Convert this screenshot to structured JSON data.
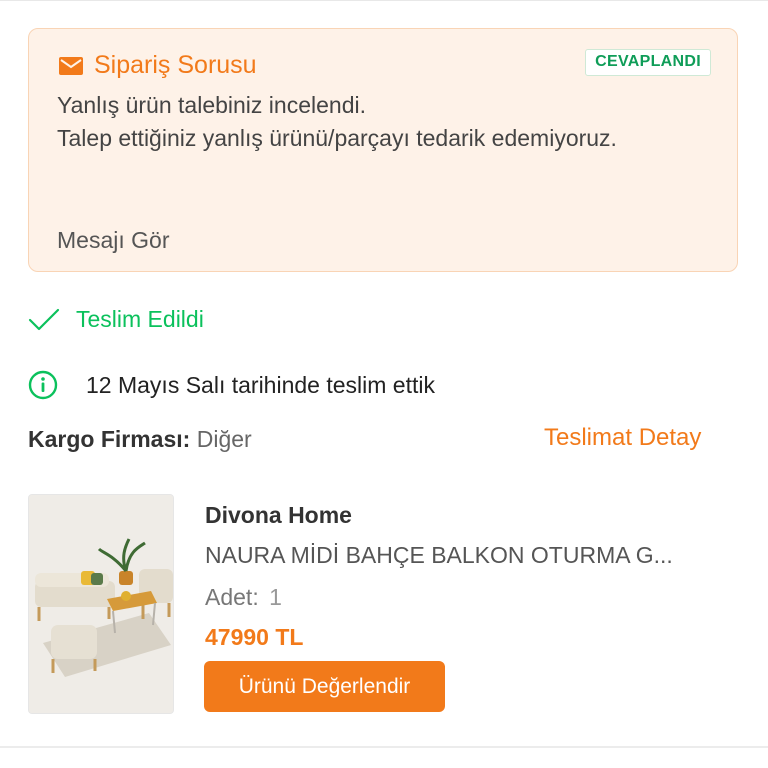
{
  "question_card": {
    "icon": "mail-icon",
    "title": "Sipariş Sorusu",
    "badge": "CEVAPLANDI",
    "message_line1": "Yanlış ürün talebiniz incelendi.",
    "message_line2": "Talep ettiğiniz yanlış ürünü/parçayı tedarik edemiyoruz.",
    "see_message": "Mesajı Gör"
  },
  "delivery": {
    "status_icon": "check-icon",
    "status": "Teslim Edildi",
    "info_icon": "info-icon",
    "info": "12 Mayıs Salı tarihinde teslim ettik",
    "cargo_label": "Kargo Firması:",
    "cargo_value": "Diğer",
    "detail_link": "Teslimat Detay"
  },
  "product": {
    "brand": "Divona Home",
    "name": "NAURA MİDİ BAHÇE BALKON OTURMA G...",
    "qty_label": "Adet:",
    "qty_value": "1",
    "price": "47990 TL",
    "rate_button": "Ürünü Değerlendir"
  },
  "colors": {
    "accent": "#f27a1a",
    "success": "#0bc15c",
    "badge_green": "#0f9d58",
    "card_bg": "#fef2e8"
  }
}
